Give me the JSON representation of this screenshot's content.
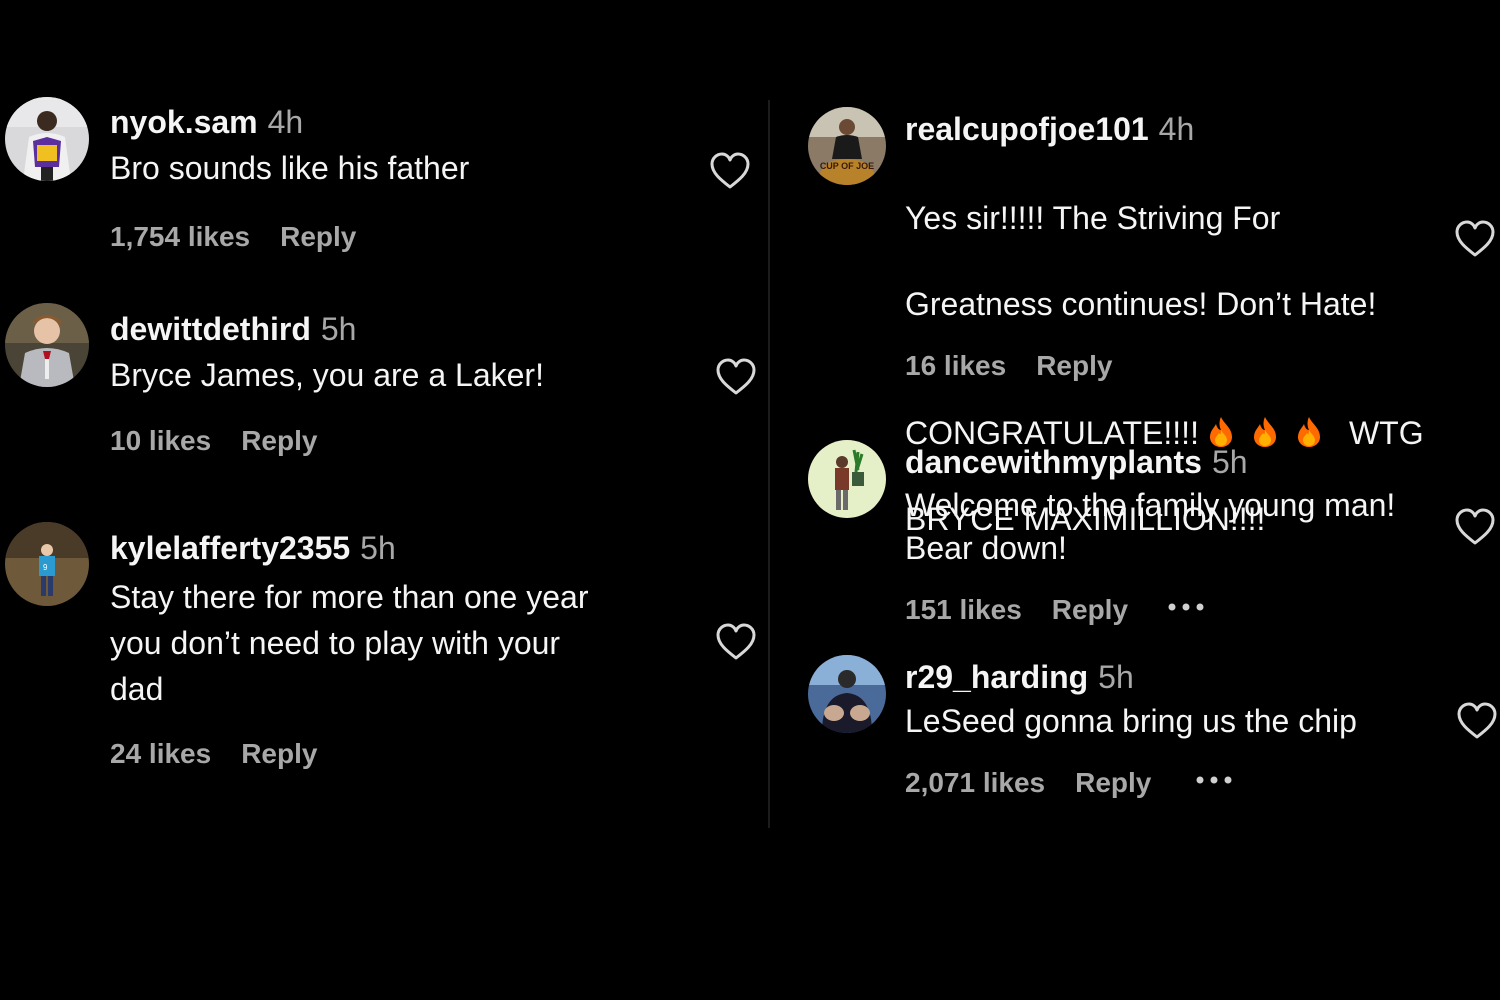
{
  "colors": {
    "background": "#000000",
    "text": "#f5f5f5",
    "secondary": "#a8a8a8",
    "fire": "#ff7a00"
  },
  "left_column": [
    {
      "username": "nyok.sam",
      "time": "4h",
      "text": "Bro sounds like his father",
      "likes": "1,754 likes",
      "reply": "Reply",
      "avatar_icon": "avatar-photo",
      "like_icon": "heart-outline-icon"
    },
    {
      "username": "dewittdethird",
      "time": "5h",
      "text": "Bryce James, you are a Laker!",
      "likes": "10 likes",
      "reply": "Reply",
      "avatar_icon": "avatar-photo",
      "like_icon": "heart-outline-icon"
    },
    {
      "username": "kylelafferty2355",
      "time": "5h",
      "text": "Stay there for more than one year\nyou don’t need to play with your\ndad",
      "likes": "24 likes",
      "reply": "Reply",
      "avatar_icon": "avatar-photo",
      "like_icon": "heart-outline-icon"
    }
  ],
  "right_column": [
    {
      "username": "realcupofjoe101",
      "time": "4h",
      "text_line1": "Yes sir!!!!! The Striving For",
      "text_line2": "Greatness continues! Don’t Hate!",
      "text_line3_a": "CONGRATULATE!!!!",
      "text_line3_b": "WTG",
      "text_line4": "BRYCE MAXIMILLION!!!!",
      "emoji_icons": [
        "fire-emoji-icon",
        "fire-emoji-icon",
        "fire-emoji-icon"
      ],
      "avatar_logo_text": "CUP OF JOE",
      "likes": "16 likes",
      "reply": "Reply",
      "like_icon": "heart-outline-icon"
    },
    {
      "username": "dancewithmyplants",
      "time": "5h",
      "text": "Welcome to the family young man!\nBear down!",
      "likes": "151 likes",
      "reply": "Reply",
      "more_icon": "more-options-icon",
      "like_icon": "heart-outline-icon"
    },
    {
      "username": "r29_harding",
      "time": "5h",
      "text": "LeSeed gonna bring us the chip",
      "likes": "2,071 likes",
      "reply": "Reply",
      "more_icon": "more-options-icon",
      "like_icon": "heart-outline-icon"
    }
  ]
}
